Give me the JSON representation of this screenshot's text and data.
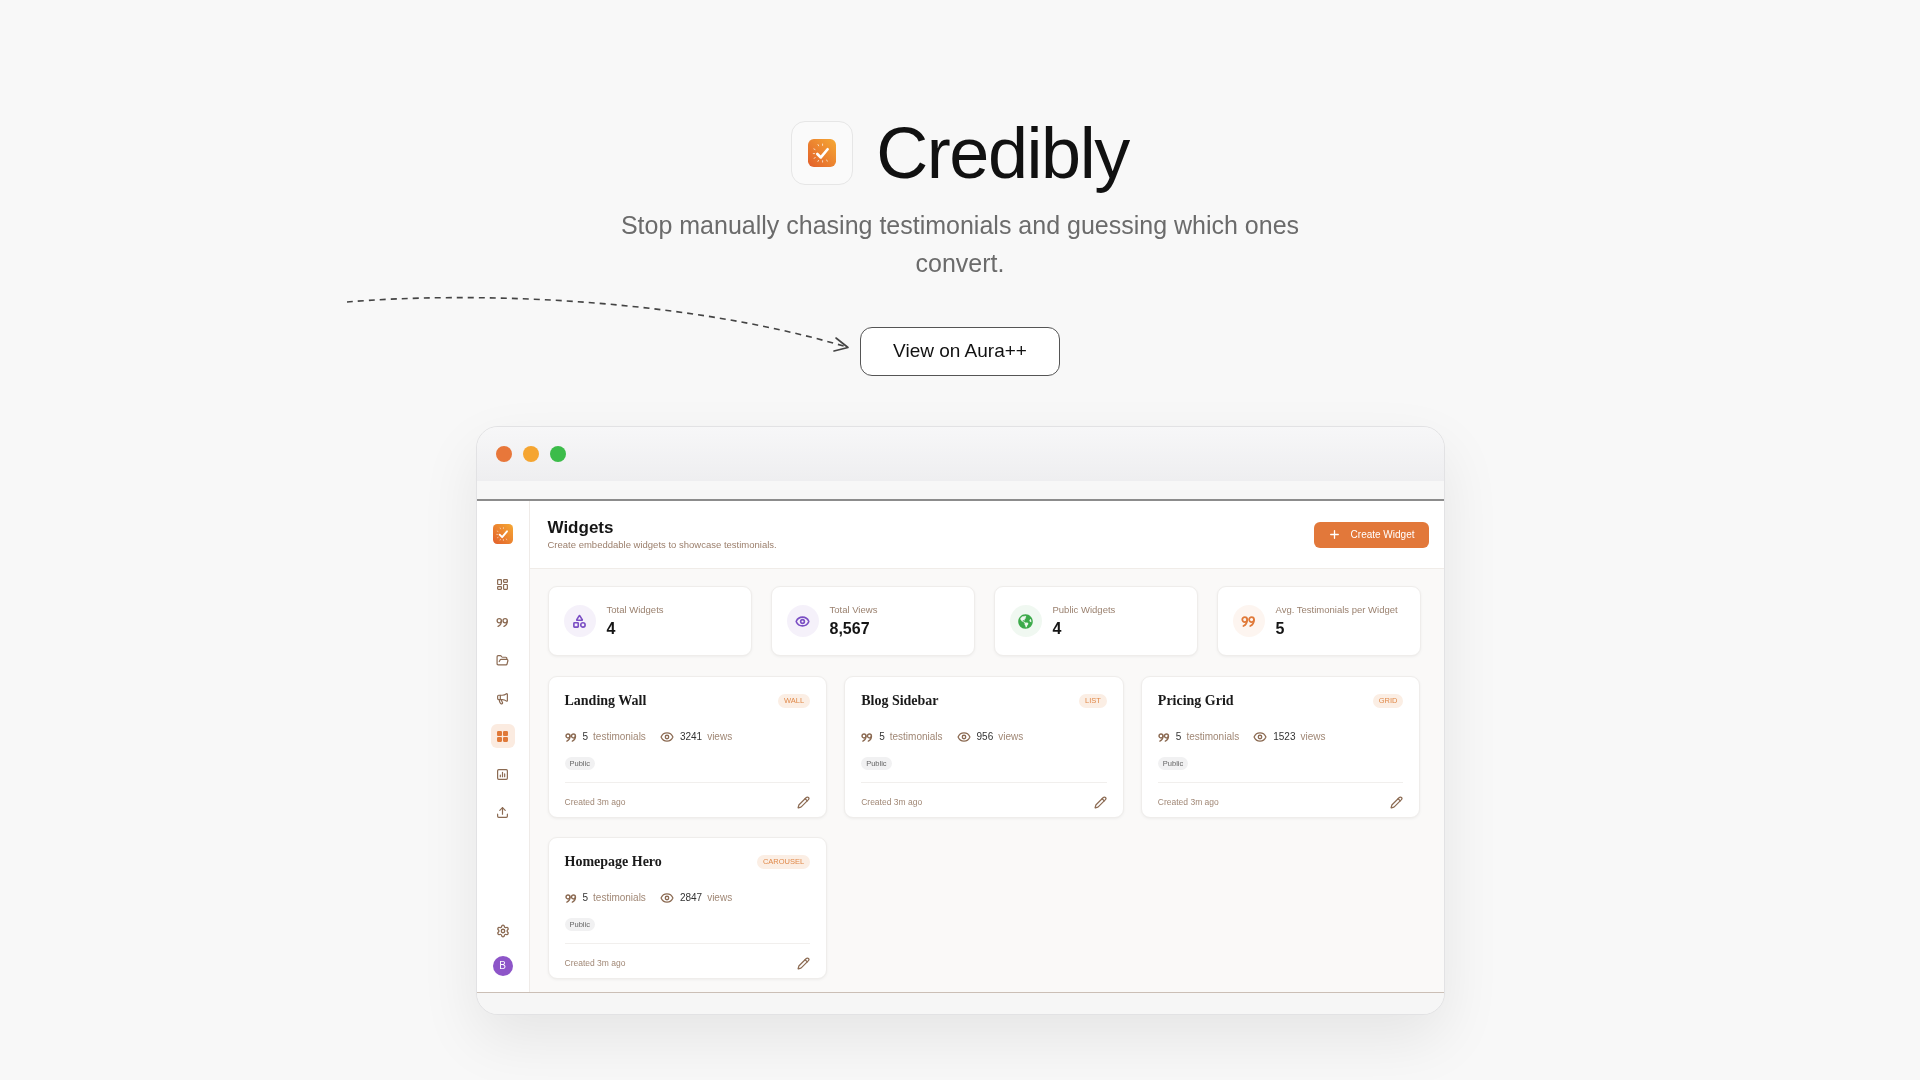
{
  "hero": {
    "title": "Credibly",
    "subtitle": "Stop manually chasing testimonials and guessing which ones convert.",
    "cta": "View on Aura++"
  },
  "app": {
    "sidebar": {
      "items": [
        {
          "selected": false
        },
        {
          "selected": false
        },
        {
          "selected": false
        },
        {
          "selected": false
        },
        {
          "selected": true
        },
        {
          "selected": false
        },
        {
          "selected": false
        }
      ],
      "avatar": "B"
    },
    "header": {
      "title": "Widgets",
      "subtitle": "Create embeddable widgets to showcase testimonials.",
      "create_button": "Create Widget"
    },
    "stats": [
      {
        "label": "Total Widgets",
        "value": "4",
        "color": "#7b4fc4"
      },
      {
        "label": "Total Views",
        "value": "8,567",
        "color": "#7b4fc4"
      },
      {
        "label": "Public Widgets",
        "value": "4",
        "color": "#3daa4b"
      },
      {
        "label": "Avg. Testimonials per Widget",
        "value": "5",
        "color": "#e07a3a"
      }
    ],
    "widgets": [
      {
        "name": "Landing Wall",
        "type": "WALL",
        "testimonials_count": "5",
        "testimonials_label": "testimonials",
        "views_count": "3241",
        "views_label": "views",
        "visibility": "Public",
        "created": "Created 3m ago"
      },
      {
        "name": "Blog Sidebar",
        "type": "LIST",
        "testimonials_count": "5",
        "testimonials_label": "testimonials",
        "views_count": "956",
        "views_label": "views",
        "visibility": "Public",
        "created": "Created 3m ago"
      },
      {
        "name": "Pricing Grid",
        "type": "GRID",
        "testimonials_count": "5",
        "testimonials_label": "testimonials",
        "views_count": "1523",
        "views_label": "views",
        "visibility": "Public",
        "created": "Created 3m ago"
      },
      {
        "name": "Homepage Hero",
        "type": "CAROUSEL",
        "testimonials_count": "5",
        "testimonials_label": "testimonials",
        "views_count": "2847",
        "views_label": "views",
        "visibility": "Public",
        "created": "Created 3m ago"
      }
    ]
  }
}
